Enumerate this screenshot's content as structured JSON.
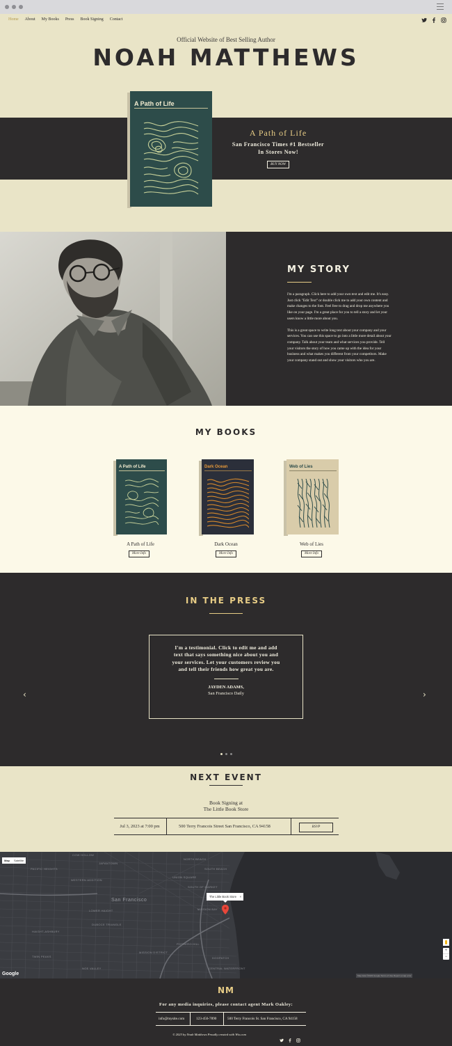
{
  "nav": {
    "items": [
      "Home",
      "About",
      "My Books",
      "Press",
      "Book Signing",
      "Contact"
    ],
    "social": [
      "twitter-icon",
      "facebook-icon",
      "instagram-icon"
    ]
  },
  "hero": {
    "subtitle": "Official Website of Best Selling Author",
    "author": "NOAH MATTHEWS",
    "book_title": "A Path of Life",
    "line1": "San Francisco Times #1 Bestseller",
    "line2": "In Stores Now!",
    "buy_label": "BUY NOW",
    "cover_title": "A Path of Life"
  },
  "story": {
    "heading": "MY STORY",
    "paragraph1": "I'm a paragraph. Click here to add your own text and edit me. It's easy. Just click \"Edit Text\" or double click me to add your own content and make changes to the font. Feel free to drag and drop me anywhere you like on your page. I'm a great place for you to tell a story and let your users know a little more about you.",
    "paragraph2": "This is a great space to write long text about your company and your services. You can use this space to go into a little more detail about your company. Talk about your team and what services you provide. Tell your visitors the story of how you came up with the idea for your business and what makes you different from your competitors. Make your company stand out and show your visitors who you are."
  },
  "books": {
    "heading": "MY BOOKS",
    "items": [
      {
        "title": "A Path of Life",
        "cover_title": "A Path of Life",
        "button": "More Info"
      },
      {
        "title": "Dark Ocean",
        "cover_title": "Dark Ocean",
        "button": "More Info"
      },
      {
        "title": "Web of Lies",
        "cover_title": "Web of Lies",
        "button": "More Info"
      }
    ]
  },
  "press": {
    "heading": "IN THE PRESS",
    "quote": "I'm a testimonial. Click to edit me and add text that says something nice about you and your services. Let your customers review you and tell their friends how great you are.",
    "name": "JAYDEN ADAMS,",
    "publication": "San Francisco Daily"
  },
  "event": {
    "heading": "NEXT EVENT",
    "name_line1": "Book Signing at",
    "name_line2": "The Little Book Store",
    "date": "Jul 3, 2023 at 7:00 pm",
    "address": "500 Terry Francois Street San Francisco, CA 94158",
    "rsvp_label": "RSVP"
  },
  "map": {
    "tabs": [
      "Map",
      "Satellite"
    ],
    "tooltip": "The Little Book Store",
    "city_label": "San Francisco",
    "labels": [
      "COW HOLLOW",
      "NORTH BEACH",
      "PACIFIC HEIGHTS",
      "JAPANTOWN",
      "UNION SQUARE",
      "SOUTH BEACH",
      "WESTERN ADDITION",
      "SOUTH OF MARKET",
      "LOWER HAIGHT",
      "MISSION BAY",
      "DUBOCE TRIANGLE",
      "POTRERO HILL",
      "MISSION DISTRICT",
      "DOGPATCH",
      "CENTRAL WATERFRONT",
      "HAIGHT-ASHBURY",
      "NOE VALLEY",
      "TWIN PEAKS"
    ],
    "google": "Google",
    "attribution": "Map data ©2023 Google   Terms of Use   Report a map error",
    "zoom_in": "+",
    "zoom_out": "−"
  },
  "footer": {
    "monogram": "NM",
    "contact_line": "For any media inquiries, please contact agent Mark Oakley:",
    "email": "info@mysite.com",
    "phone": "123-456-7890",
    "address": "500 Terry Francois St. San Francisco, CA 94158",
    "copyright": "© 2023 by Noah Matthews Proudly created with Wix.com"
  },
  "colors": {
    "cream": "#e9e4c7",
    "light_cream": "#fcf9e8",
    "charcoal": "#2d2b2c",
    "gold": "#e8cd86",
    "teal_cover": "#2d4c4a",
    "navy_cover": "#2b2f3a",
    "beige_cover": "#d9ccaa"
  }
}
